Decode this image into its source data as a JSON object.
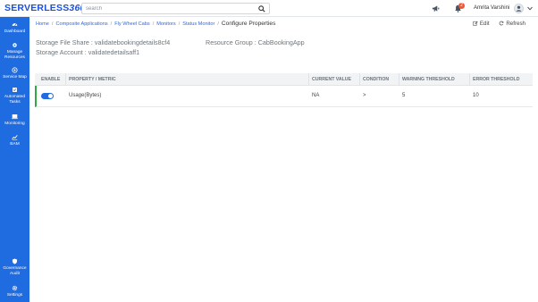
{
  "app": {
    "logo_text": "SERVERLESS",
    "logo_num": "360"
  },
  "header": {
    "search_placeholder": "search",
    "notification_count": "2",
    "user_name": "Amrita Varshini"
  },
  "sidebar": {
    "items": [
      {
        "label": "Dashboard",
        "icon": "dashboard-icon"
      },
      {
        "label": "Manage Resources",
        "icon": "manage-resources-icon"
      },
      {
        "label": "Service Map",
        "icon": "service-map-icon"
      },
      {
        "label": "Automated Tasks",
        "icon": "automated-tasks-icon"
      },
      {
        "label": "Monitoring",
        "icon": "monitoring-icon"
      },
      {
        "label": "BAM",
        "icon": "bam-icon"
      },
      {
        "label": "Governance Audit",
        "icon": "governance-audit-icon"
      },
      {
        "label": "Settings",
        "icon": "settings-icon"
      }
    ]
  },
  "breadcrumb": {
    "items": [
      "Home",
      "Composite Applications",
      "Fly Wheel Cabs",
      "Monitors",
      "Status Monitor"
    ],
    "current": "Configure Properties"
  },
  "actions": {
    "edit": "Edit",
    "refresh": "Refresh"
  },
  "info": {
    "storage_file_share": "Storage File Share : validatebookingdetails8cf4",
    "resource_group": "Resource Group : CabBookingApp",
    "storage_account": "Storage Account : validatedetailsaff1"
  },
  "table": {
    "headers": [
      "ENABLE",
      "PROPERTY / METRIC",
      "CURRENT VALUE",
      "CONDITION",
      "WARNING THRESHOLD",
      "ERROR THRESHOLD"
    ],
    "rows": [
      {
        "enabled": true,
        "property": "Usage(Bytes)",
        "current_value": "NA",
        "condition": ">",
        "warning": "5",
        "error": "10"
      }
    ]
  },
  "colors": {
    "sidebar": "#1f6be0",
    "link": "#2f6ad8",
    "row_accent": "#31a848",
    "badge": "#e8593d"
  }
}
